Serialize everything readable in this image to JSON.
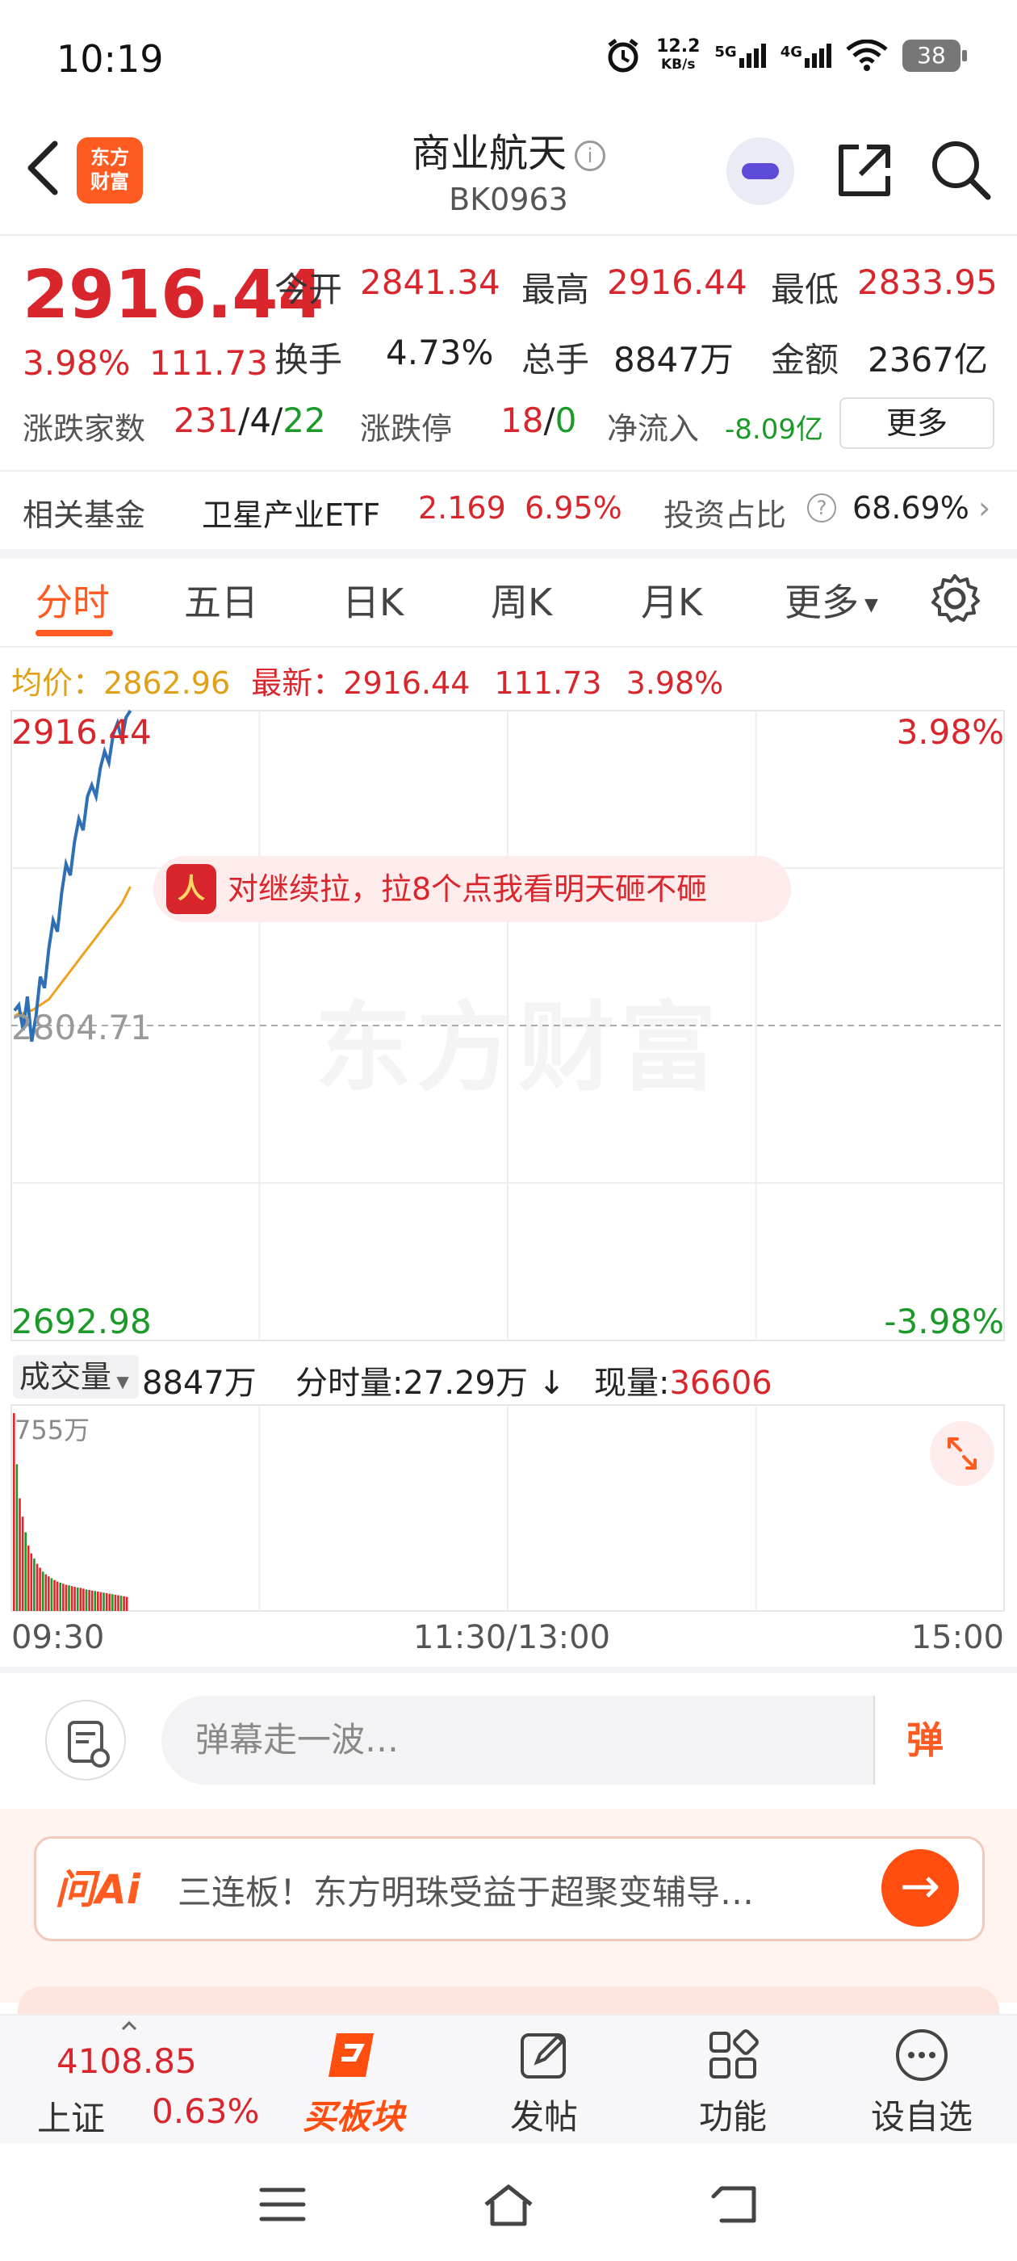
{
  "status": {
    "time": "10:19",
    "net_speed_top": "12.2",
    "net_speed_bottom": "KB/s",
    "sig1": "5G",
    "sig2": "4G",
    "battery": "38"
  },
  "header": {
    "logo_line1": "东方",
    "logo_line2": "财富",
    "title": "商业航天",
    "code": "BK0963",
    "info_glyph": "i"
  },
  "quote": {
    "price": "2916.44",
    "change_pct": "3.98%",
    "change_abs": "111.73",
    "open_label": "今开",
    "open": "2841.34",
    "high_label": "最高",
    "high": "2916.44",
    "low_label": "最低",
    "low": "2833.95",
    "turnover_label": "换手",
    "turnover": "4.73%",
    "volume_label": "总手",
    "volume": "8847万",
    "amount_label": "金额",
    "amount": "2367亿",
    "updown_label": "涨跌家数",
    "up_count": "231",
    "flat_count": "4",
    "down_count": "22",
    "limit_label": "涨跌停",
    "limit_up": "18",
    "limit_down": "0",
    "netflow_label": "净流入",
    "netflow": "-8.09亿",
    "more_button": "更多",
    "sep": "/"
  },
  "fund": {
    "label": "相关基金",
    "name": "卫星产业ETF",
    "price": "2.169",
    "pct": "6.95%",
    "ratio_label": "投资占比",
    "ratio": "68.69%",
    "help": "?",
    "chevron": "›"
  },
  "tabs": [
    {
      "label": "分时"
    },
    {
      "label": "五日"
    },
    {
      "label": "日K"
    },
    {
      "label": "周K"
    },
    {
      "label": "月K"
    },
    {
      "label": "更多"
    }
  ],
  "avg_bar": {
    "avg_label": "均价：",
    "avg": "2862.96",
    "latest_label": "最新：",
    "latest": "2916.44",
    "chg": "111.73",
    "pct": "3.98%"
  },
  "chart": {
    "top_price": "2916.44",
    "top_pct": "3.98%",
    "mid_price": "2804.71",
    "bottom_price": "2692.98",
    "bottom_pct": "-3.98%",
    "watermark": "东方财富",
    "comment": "对继续拉，拉8个点我看明天砸不砸",
    "comment_icon": "人"
  },
  "volume_bar": {
    "selector": "成交量",
    "total": "8847万",
    "minute_label": "分时量:",
    "minute": "27.29万",
    "arrow": "↓",
    "now_label": "现量:",
    "now": "36606",
    "max_label": "755万"
  },
  "time_axis": {
    "start": "09:30",
    "mid": "11:30/13:00",
    "end": "15:00"
  },
  "danmaku": {
    "placeholder": "弹幕走一波…",
    "button": "弹"
  },
  "ai": {
    "logo": "问Ai",
    "text": "三连板！东方明珠受益于超聚变辅导…",
    "go": "→"
  },
  "bottom_nav": {
    "index_value": "4108.85",
    "index_name": "上证",
    "index_pct": "0.63%",
    "buy_label": "买板块",
    "post_label": "发帖",
    "func_label": "功能",
    "watch_label": "设自选"
  },
  "chart_data": {
    "type": "line",
    "title": "",
    "ylim": [
      2692.98,
      2916.44
    ],
    "prev_close": 2804.71,
    "series": [
      {
        "name": "",
        "values": [
          2810,
          2812,
          2803,
          2815,
          2799,
          2808,
          2822,
          2818,
          2832,
          2842,
          2838,
          2852,
          2862,
          2858,
          2870,
          2878,
          2874,
          2886,
          2890,
          2886,
          2896,
          2902,
          2898,
          2908,
          2912,
          2906,
          2914,
          2916.44
        ]
      },
      {
        "name": "均价",
        "values": [
          2808,
          2809,
          2809,
          2810,
          2810,
          2811,
          2812,
          2813,
          2814,
          2816,
          2818,
          2820,
          2822,
          2824,
          2826,
          2828,
          2830,
          2832,
          2834,
          2836,
          2838,
          2840,
          2842,
          2844,
          2846,
          2848,
          2851,
          2854
        ]
      }
    ],
    "volume": [
      755,
      560,
      430,
      360,
      300,
      250,
      220,
      200,
      180,
      165,
      150,
      140,
      132,
      125,
      118,
      112,
      108,
      104,
      100,
      98,
      95,
      92,
      90,
      88,
      85,
      82,
      80,
      78,
      76,
      74,
      72,
      70,
      68,
      66,
      64,
      62,
      60,
      58,
      56,
      54
    ]
  }
}
